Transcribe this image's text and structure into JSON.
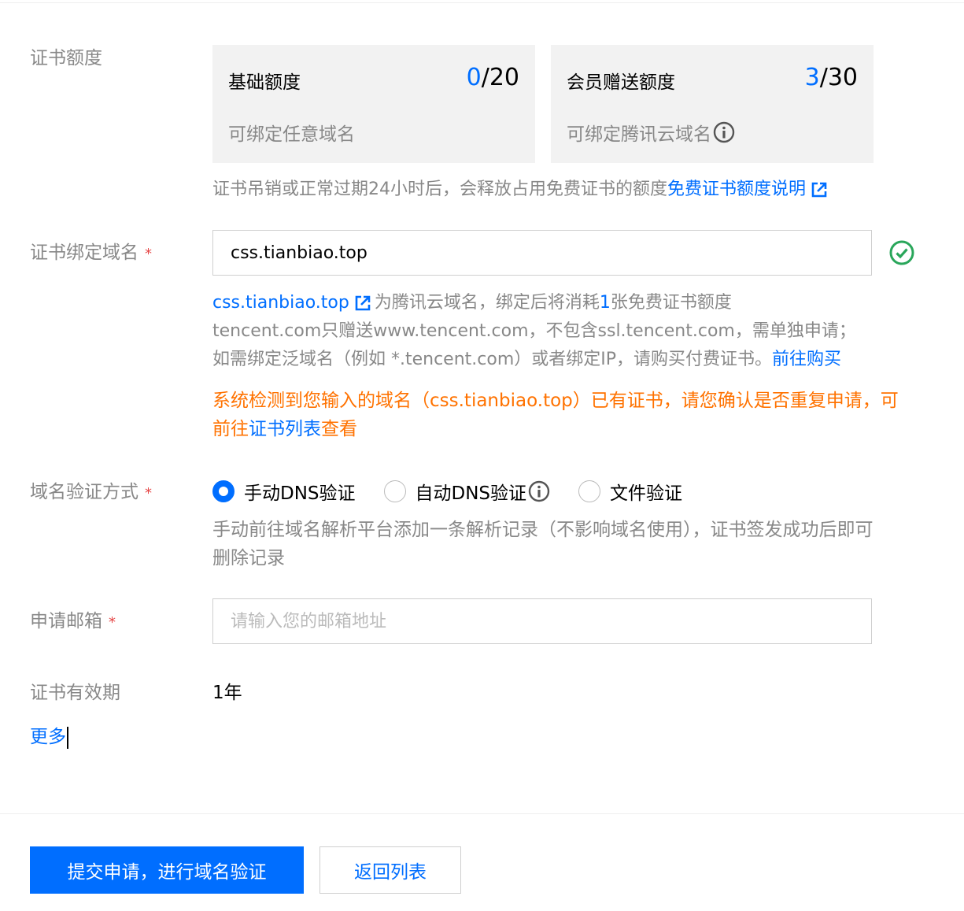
{
  "quota": {
    "label": "证书额度",
    "basic": {
      "name": "基础额度",
      "used": "0",
      "total": "/20",
      "desc": "可绑定任意域名"
    },
    "member": {
      "name": "会员赠送额度",
      "used": "3",
      "total": "/30",
      "desc": "可绑定腾讯云域名"
    },
    "hint": "证书吊销或正常过期24小时后，会释放占用免费证书的额度",
    "hint_link": "免费证书额度说明"
  },
  "domain": {
    "label": "证书绑定域名",
    "value": "css.tianbiao.top",
    "info_domain": "css.tianbiao.top",
    "info_text1": "为腾讯云域名，绑定后将消耗",
    "info_count": "1",
    "info_text2": "张免费证书额度",
    "line2": "tencent.com只赠送www.tencent.com，不包含ssl.tencent.com，需单独申请；",
    "line3": "如需绑定泛域名（例如 *.tencent.com）或者绑定IP，请购买付费证书。",
    "line3_link": "前往购买",
    "warn_text1": "系统检测到您输入的域名（css.tianbiao.top）已有证书，请您确认是否重复申请，可",
    "warn_text2": "前往",
    "warn_link": "证书列表",
    "warn_text3": "查看"
  },
  "verify": {
    "label": "域名验证方式",
    "options": [
      "手动DNS验证",
      "自动DNS验证",
      "文件验证"
    ],
    "selected": "手动DNS验证",
    "hint_line1": "手动前往域名解析平台添加一条解析记录（不影响域名使用），证书签发成功后即可",
    "hint_line2": "删除记录"
  },
  "email": {
    "label": "申请邮箱",
    "placeholder": "请输入您的邮箱地址"
  },
  "validity": {
    "label": "证书有效期",
    "value": "1年"
  },
  "more": "更多",
  "buttons": {
    "submit": "提交申请，进行域名验证",
    "back": "返回列表"
  },
  "required_mark": "*",
  "colors": {
    "primary": "#006eff",
    "warning": "#ff7200",
    "success": "#29a65a",
    "required": "#e54545"
  }
}
